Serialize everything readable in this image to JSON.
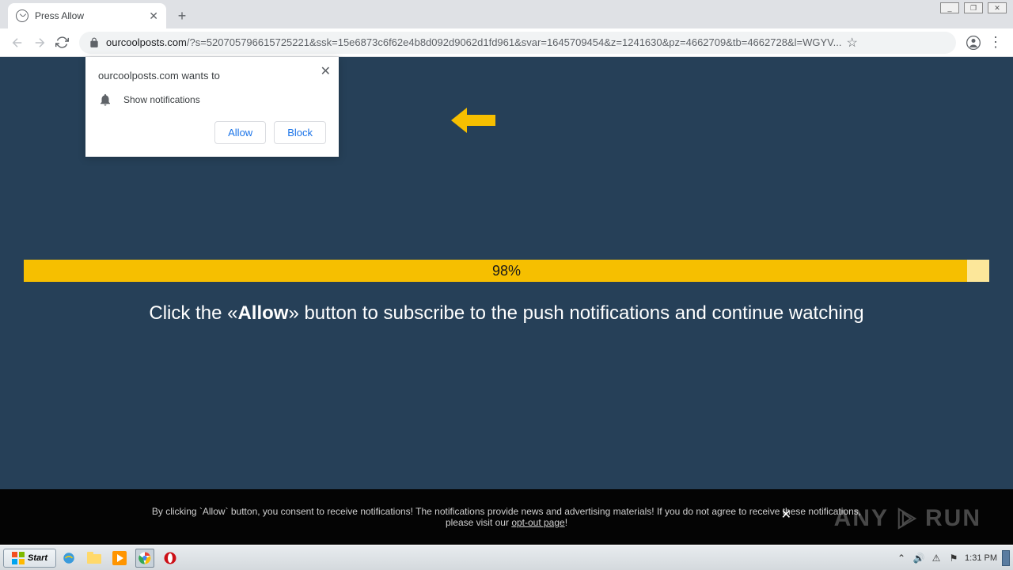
{
  "window": {
    "minimize": "_",
    "maximize": "❐",
    "close": "✕"
  },
  "tab": {
    "title": "Press Allow"
  },
  "url": {
    "domain": "ourcoolposts.com",
    "path": "/?s=520705796615725221&ssk=15e6873c6f62e4b8d092d9062d1fd961&svar=1645709454&z=1241630&pz=4662709&tb=4662728&l=WGYV..."
  },
  "notification": {
    "title": "ourcoolposts.com wants to",
    "permission": "Show notifications",
    "allow": "Allow",
    "block": "Block"
  },
  "page": {
    "progress_pct": "98%",
    "instruction_pre": "Click the «",
    "instruction_bold": "Allow",
    "instruction_post": "» button to subscribe to the push notifications and continue watching"
  },
  "consent": {
    "line1": "By clicking `Allow` button, you consent to receive notifications! The notifications provide news and advertising materials! If you do not agree to receive these notifications,",
    "line2_pre": "please visit our ",
    "link": "opt-out page",
    "line2_post": "!"
  },
  "watermark": {
    "text1": "ANY",
    "text2": "RUN"
  },
  "taskbar": {
    "start": "Start",
    "time": "1:31 PM"
  }
}
